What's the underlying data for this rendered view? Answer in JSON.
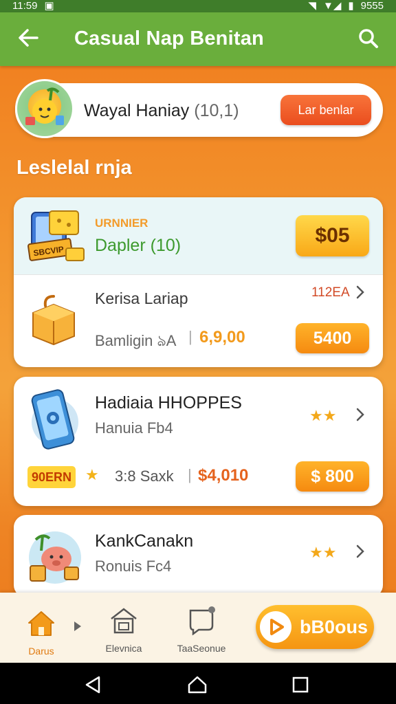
{
  "status_bar": {
    "time": "11:59",
    "battery": "9555"
  },
  "app_bar": {
    "title": "Casual Nap Benitan"
  },
  "profile": {
    "name": "Wayal Haniay",
    "count": "(10,1)",
    "button": "Lar benlar"
  },
  "section_title": "Leslelal rnja",
  "cards": [
    {
      "tag": "URNNIER",
      "name": "Dapler (10)",
      "price": "$05",
      "sub_name": "Kerisa Lariap",
      "sub_code": "112EA",
      "sub_meta": "Bamligin ঌA",
      "sub_value": "6,9,00",
      "sub_price": "5400"
    },
    {
      "name": "Hadiaia HHOPPES",
      "subtitle": "Hanuia Fb4",
      "badge": "90ERN",
      "rating_text": "3:8 Saxk",
      "value": "$4,010",
      "price": "$ 800"
    },
    {
      "name": "KankCanakn",
      "subtitle": "Ronuis Fc4"
    }
  ],
  "bottom_nav": {
    "items": [
      {
        "label": "Darus"
      },
      {
        "label": "Elevnica"
      },
      {
        "label": "TaaSeonue"
      }
    ],
    "bonus": "bB0ous"
  },
  "colors": {
    "appbar": "#6aae3c",
    "background": "#f08a28",
    "accent_orange": "#f58a10",
    "cta_red": "#ea4d1e"
  }
}
